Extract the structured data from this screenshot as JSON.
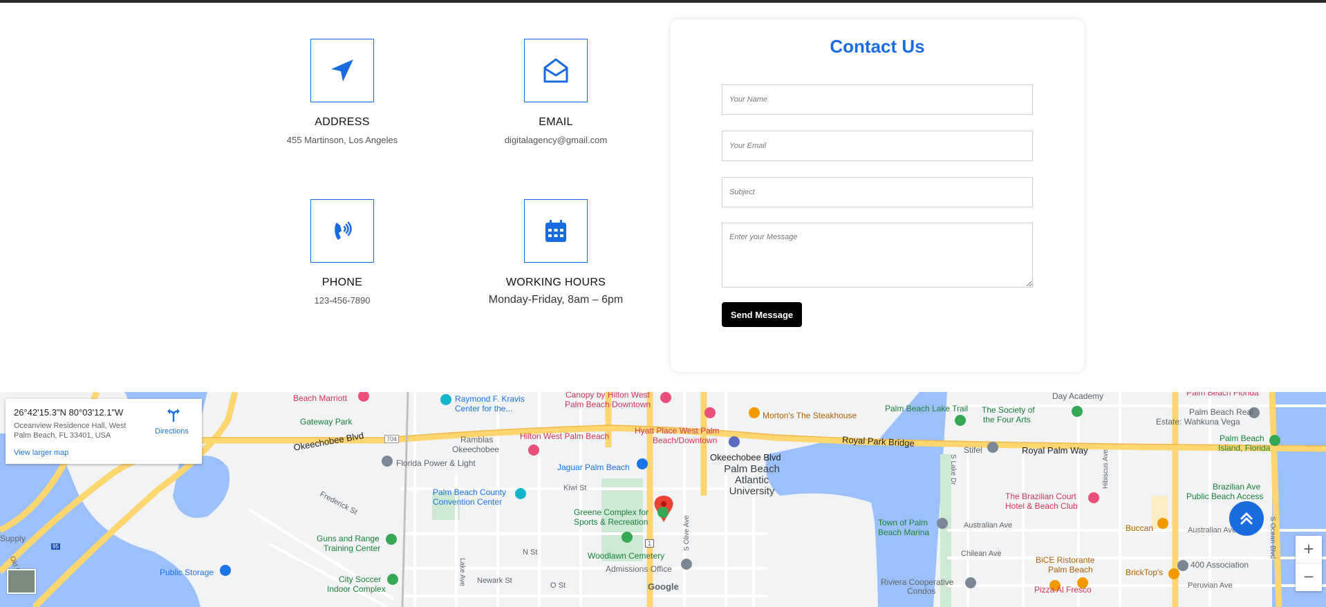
{
  "info": {
    "address": {
      "title": "ADDRESS",
      "value": "455 Martinson, Los Angeles"
    },
    "email": {
      "title": "EMAIL",
      "value": "digitalagency@gmail.com"
    },
    "phone": {
      "title": "PHONE",
      "value": "123-456-7890"
    },
    "hours": {
      "title": "WORKING HOURS",
      "value": "Monday-Friday, 8am – 6pm"
    }
  },
  "contact": {
    "title": "Contact Us",
    "name_placeholder": "Your Name",
    "email_placeholder": "Your Email",
    "subject_placeholder": "Subject",
    "message_placeholder": "Enter your Message",
    "send_label": "Send Message"
  },
  "map": {
    "card": {
      "coords": "26°42'15.3\"N 80°03'12.1\"W",
      "address": "Oceanview Residence Hall, West Palm Beach, FL 33401, USA",
      "directions_label": "Directions",
      "larger_map_label": "View larger map"
    },
    "labels": {
      "beach_marriott": "Beach Marriott",
      "raymond_kravis": "Raymond F. Kravis",
      "center_for": "Center for the...",
      "canopy_1": "Canopy by Hilton West",
      "canopy_2": "Palm Beach Downtown",
      "mortons": "Morton's The Steakhouse",
      "pb_lake_trail": "Palm Beach Lake Trail",
      "society_1": "The Society of",
      "society_2": "the Four Arts",
      "day_academy": "Day Academy",
      "pb_florida": "Palm Beach Florida",
      "pb_real_estate_1": "Palm Beach Real",
      "pb_real_estate_2": "Estate: Wahkuna Vega",
      "gateway_park": "Gateway Park",
      "okeechobee_blvd_w": "Okeechobee Blvd",
      "route_704": "704",
      "ramblas_1": "Ramblas",
      "ramblas_2": "Okeechobee",
      "hilton": "Hilton West Palm Beach",
      "hyatt_1": "Hyatt Place West Palm",
      "hyatt_2": "Beach/Downtown",
      "royal_park_bridge": "Royal Park Bridge",
      "stifel": "Stifel",
      "royal_palm_way": "Royal Palm Way",
      "pb_island_1": "Palm Beach",
      "pb_island_2": "Island, Florida",
      "florida_power": "Florida Power & Light",
      "jaguar": "Jaguar Palm Beach",
      "okeechobee_blvd_e": "Okeechobee Blvd",
      "pba_1": "Palm Beach",
      "pba_2": "Atlantic",
      "pba_3": "University",
      "kiwi_st": "Kiwi St",
      "convention_1": "Palm Beach County",
      "convention_2": "Convention Center",
      "frederick_st": "Frederick St",
      "greene_1": "Greene Complex for",
      "greene_2": "Sports & Recreation",
      "s_olive_ave": "S Olive Ave",
      "town_of_pb_1": "Town of Palm",
      "town_of_pb_2": "Beach Marina",
      "australian_ave": "Australian Ave",
      "brazilian_court_1": "The Brazilian Court",
      "brazilian_court_2": "Hotel & Beach Club",
      "hibiscus_ave": "Hibiscus Ave",
      "lake_dr": "S Lake Dr",
      "brazilian_ave": "Brazilian Ave",
      "pb_access": "Public Beach Access",
      "buccan": "Buccan",
      "australian_ave_e": "Australian Ave",
      "guns_1": "Guns and Range",
      "guns_2": "Training Center",
      "supply": "Supply",
      "n_st": "N St",
      "woodlawn": "Woodlawn Cemetery",
      "admissions": "Admissions Office",
      "chilean_ave": "Chilean Ave",
      "bice_1": "BiCE Ristorante",
      "bice_2": "Palm Beach",
      "four_hundred": "400 Association",
      "brick_tops": "BrickTop's",
      "s_ocean_blvd": "S Ocean Blvd",
      "public_storage": "Public Storage",
      "city_soccer_1": "City Soccer",
      "city_soccer_2": "Indoor Complex",
      "newark_st": "Newark St",
      "o_st": "O St",
      "google": "Google",
      "riviera_1": "Riviera Cooperative",
      "riviera_2": "Condos",
      "pizza": "Pizza Al Fresco",
      "peruvian": "Peruvian Ave",
      "lake_ave": "Lake Ave",
      "route_1": "1",
      "old_rd": "Old Pr",
      "interstate": "95"
    },
    "zoom_in": "+",
    "zoom_out": "−"
  },
  "colors": {
    "accent": "#1a6be0",
    "water": "#9cc0f9",
    "road_major": "#fdd66f",
    "map_bg": "#f1f3f4",
    "marker": "#ea4335"
  }
}
